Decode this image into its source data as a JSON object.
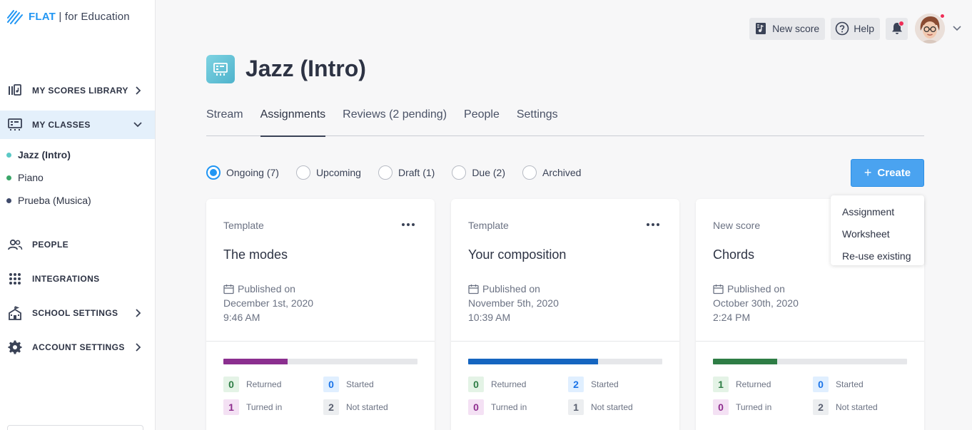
{
  "logo": {
    "brand": "FLAT",
    "separator": " | ",
    "suffix": "for Education"
  },
  "sidebar": {
    "nav": [
      {
        "label": "MY SCORES LIBRARY",
        "icon": "library-icon"
      },
      {
        "label": "MY CLASSES",
        "icon": "classes-icon"
      },
      {
        "label": "PEOPLE",
        "icon": "people-icon"
      },
      {
        "label": "INTEGRATIONS",
        "icon": "grid-icon"
      },
      {
        "label": "SCHOOL SETTINGS",
        "icon": "school-icon"
      },
      {
        "label": "ACCOUNT SETTINGS",
        "icon": "gear-icon"
      }
    ],
    "classes": [
      {
        "label": "Jazz (Intro)",
        "color": "#5cc9c6"
      },
      {
        "label": "Piano",
        "color": "#3aa668"
      },
      {
        "label": "Prueba (Musica)",
        "color": "#3f4a6b"
      }
    ]
  },
  "topbar": {
    "new_score": "New score",
    "help": "Help"
  },
  "class_header": {
    "title": "Jazz (Intro)"
  },
  "tabs": [
    "Stream",
    "Assignments",
    "Reviews (2 pending)",
    "People",
    "Settings"
  ],
  "filters": [
    "Ongoing (7)",
    "Upcoming",
    "Draft (1)",
    "Due (2)",
    "Archived"
  ],
  "create": {
    "label": "Create",
    "menu": [
      "Assignment",
      "Worksheet",
      "Re-use existing"
    ]
  },
  "cards": [
    {
      "kind": "Template",
      "title": "The modes",
      "published_label": "Published on",
      "date": "December 1st, 2020",
      "time": "9:46 AM",
      "progress": 0.33,
      "progress_color": "#8b2f8f",
      "returned": "0",
      "returned_label": "Returned",
      "started": "0",
      "started_label": "Started",
      "turned_in": "1",
      "turned_in_label": "Turned in",
      "not_started": "2",
      "not_started_label": "Not started"
    },
    {
      "kind": "Template",
      "title": "Your composition",
      "published_label": "Published on",
      "date": "November 5th, 2020",
      "time": "10:39 AM",
      "progress": 0.67,
      "progress_color": "#1565c0",
      "returned": "0",
      "returned_label": "Returned",
      "started": "2",
      "started_label": "Started",
      "turned_in": "0",
      "turned_in_label": "Turned in",
      "not_started": "1",
      "not_started_label": "Not started"
    },
    {
      "kind": "New score",
      "title": "Chords",
      "published_label": "Published on",
      "date": "October 30th, 2020",
      "time": "2:24 PM",
      "progress": 0.33,
      "progress_color": "#2e7d45",
      "returned": "1",
      "returned_label": "Returned",
      "started": "0",
      "started_label": "Started",
      "turned_in": "0",
      "turned_in_label": "Turned in",
      "not_started": "2",
      "not_started_label": "Not started"
    }
  ]
}
